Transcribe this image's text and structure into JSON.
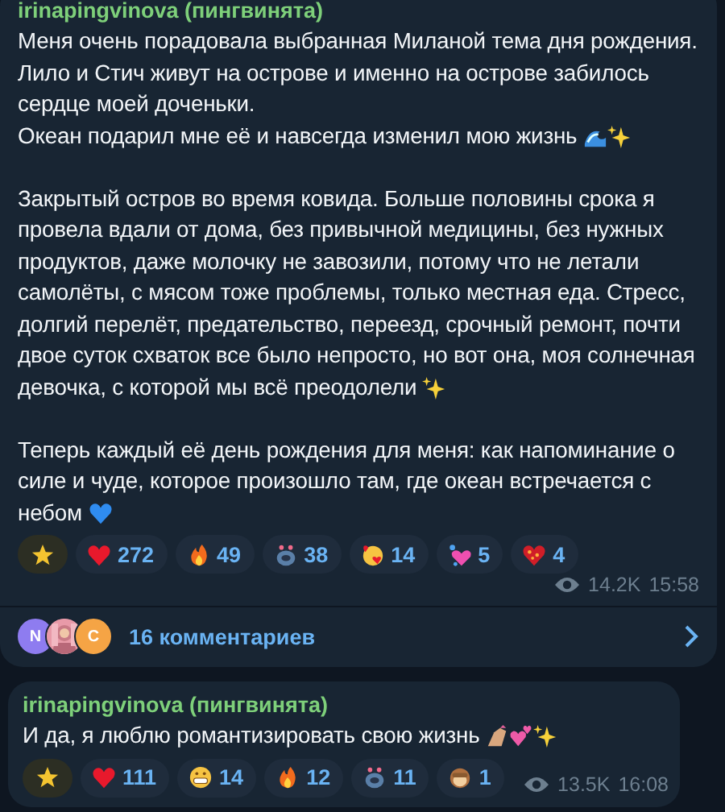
{
  "posts": [
    {
      "author": "irinapingvinova (пингвинята)",
      "paragraphs": [
        {
          "text": "Меня очень порадовала выбранная  Миланой тема дня рождения. Лило и Стич живут на острове и именно на острове забилось сердце моей доченьки.\nОкеан подарил мне её и навсегда изменил мою жизнь",
          "icons": [
            {
              "kind": "wave"
            },
            {
              "kind": "sparkles"
            }
          ]
        },
        {
          "text": "Закрытый остров во время ковида. Больше половины срока я провела вдали от дома, без привычной медицины, без нужных продуктов, даже молочку не завозили, потому что не летали самолёты, с мясом тоже проблемы, только местная еда. Стресс, долгий перелёт, предательство, переезд, срочный ремонт, почти двое суток схваток все было непросто, но вот она, моя солнечная девочка, с которой мы всё преодолели",
          "icons": [
            {
              "kind": "sparkles"
            }
          ]
        },
        {
          "text": "Теперь каждый её день рождения для меня: как напоминание о силе и чуде, которое произошло там, где океан встречается с небом",
          "icons": [
            {
              "kind": "blue-heart"
            }
          ]
        }
      ],
      "reactions": [
        {
          "kind": "star"
        },
        {
          "kind": "heart",
          "count": "272"
        },
        {
          "kind": "fire",
          "count": "49"
        },
        {
          "kind": "character",
          "count": "38"
        },
        {
          "kind": "kiss",
          "count": "14"
        },
        {
          "kind": "hearts",
          "count": "5"
        },
        {
          "kind": "heart-burst",
          "count": "4"
        }
      ],
      "views": "14.2K",
      "time": "15:58",
      "comments": {
        "avatars": [
          {
            "kind": "letter",
            "letter": "N",
            "color": "#8e7cf0"
          },
          {
            "kind": "picture",
            "color": "#e89aa8"
          },
          {
            "kind": "letter",
            "letter": "C",
            "color": "#f5a445"
          }
        ],
        "label": "16 комментариев"
      }
    },
    {
      "author": "irinapingvinova (пингвинята)",
      "paragraphs": [
        {
          "text": "И да, я люблю романтизировать свою жизнь",
          "icons": [
            {
              "kind": "nails"
            },
            {
              "kind": "hearts-pink"
            },
            {
              "kind": "sparkles"
            }
          ]
        }
      ],
      "reactions": [
        {
          "kind": "star"
        },
        {
          "kind": "heart",
          "count": "111"
        },
        {
          "kind": "grin",
          "count": "14"
        },
        {
          "kind": "fire",
          "count": "12"
        },
        {
          "kind": "character",
          "count": "11"
        },
        {
          "kind": "monkey",
          "count": "1"
        }
      ],
      "views": "13.5K",
      "time": "16:08"
    }
  ]
}
